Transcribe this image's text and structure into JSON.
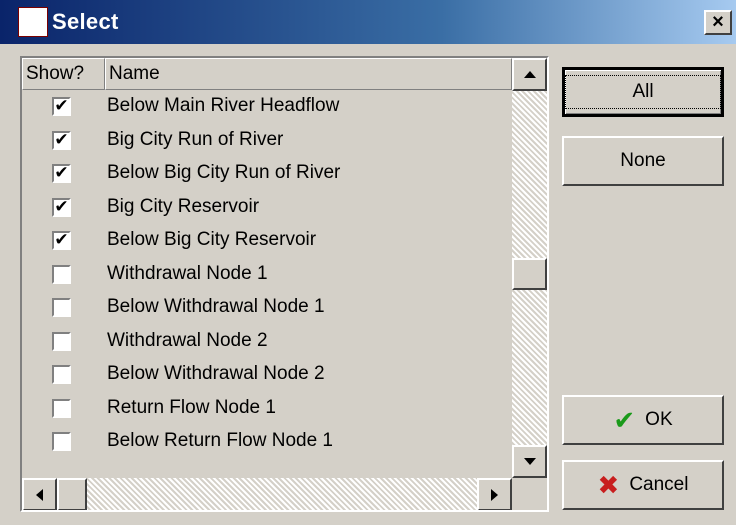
{
  "window": {
    "title": "Select",
    "close_label": "×",
    "icon": "app-icon"
  },
  "list": {
    "columns": [
      "Show?",
      "Name"
    ],
    "rows": [
      {
        "name": "Below Main River Headflow",
        "checked": true
      },
      {
        "name": "Big City Run of River",
        "checked": true
      },
      {
        "name": "Below Big City Run of River",
        "checked": true
      },
      {
        "name": "Big City Reservoir",
        "checked": true
      },
      {
        "name": "Below Big City Reservoir",
        "checked": true
      },
      {
        "name": "Withdrawal Node 1",
        "checked": false
      },
      {
        "name": "Below Withdrawal Node 1",
        "checked": false
      },
      {
        "name": "Withdrawal Node 2",
        "checked": false
      },
      {
        "name": "Below Withdrawal Node 2",
        "checked": false
      },
      {
        "name": "Return Flow Node 1",
        "checked": false
      },
      {
        "name": "Below Return Flow Node 1",
        "checked": false
      }
    ],
    "check_mark": "✔"
  },
  "buttons": {
    "all": "All",
    "none": "None",
    "ok": "OK",
    "cancel": "Cancel",
    "ok_icon": "✔",
    "cancel_icon": "✖"
  },
  "colors": {
    "title_bar": "#0a246a",
    "ok_icon": "#1a9a1a",
    "cancel_icon": "#c81e1e"
  }
}
